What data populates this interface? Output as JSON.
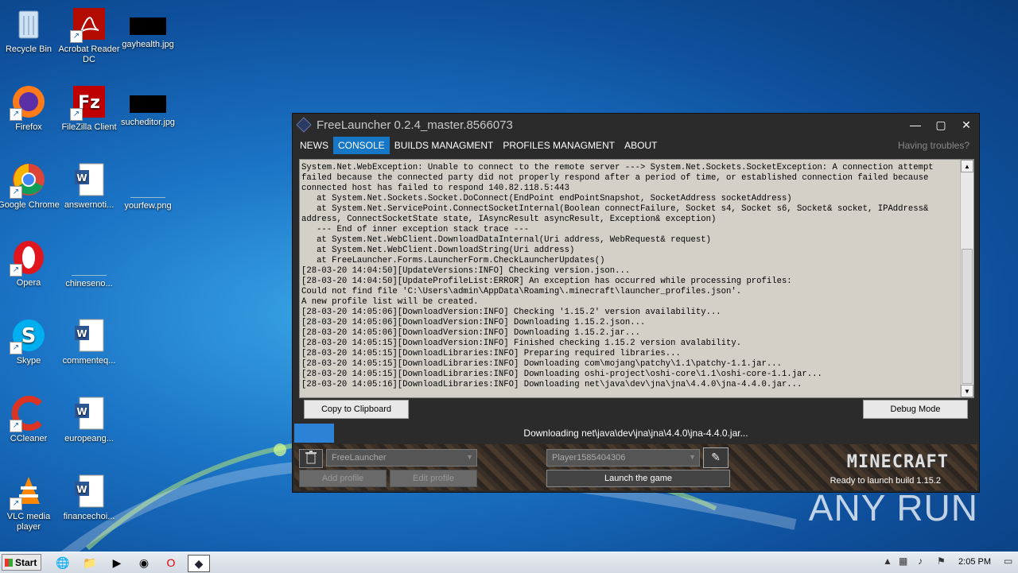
{
  "desktop": {
    "icons": [
      {
        "label": "Recycle Bin"
      },
      {
        "label": "Acrobat Reader DC"
      },
      {
        "label": "gayhealth.jpg"
      },
      {
        "label": "Firefox"
      },
      {
        "label": "FileZilla Client"
      },
      {
        "label": "sucheditor.jpg"
      },
      {
        "label": "Google Chrome"
      },
      {
        "label": "answernoti..."
      },
      {
        "label": "yourfew.png"
      },
      {
        "label": "Opera"
      },
      {
        "label": "chineseno..."
      },
      {
        "label": "Skype"
      },
      {
        "label": "commenteq..."
      },
      {
        "label": "CCleaner"
      },
      {
        "label": "europeang..."
      },
      {
        "label": "VLC media player"
      },
      {
        "label": "financechoi..."
      }
    ]
  },
  "window": {
    "title": "FreeLauncher 0.2.4_master.8566073",
    "controls": {
      "minimize": "—",
      "maximize": "▢",
      "close": "✕"
    },
    "tabs": [
      {
        "label": "NEWS"
      },
      {
        "label": "CONSOLE"
      },
      {
        "label": "BUILDS MANAGMENT"
      },
      {
        "label": "PROFILES MANAGMENT"
      },
      {
        "label": "ABOUT"
      }
    ],
    "help": "Having troubles?",
    "console_log": "System.Net.WebException: Unable to connect to the remote server ---> System.Net.Sockets.SocketException: A connection attempt failed because the connected party did not properly respond after a period of time, or established connection failed because connected host has failed to respond 140.82.118.5:443\n   at System.Net.Sockets.Socket.DoConnect(EndPoint endPointSnapshot, SocketAddress socketAddress)\n   at System.Net.ServicePoint.ConnectSocketInternal(Boolean connectFailure, Socket s4, Socket s6, Socket& socket, IPAddress& address, ConnectSocketState state, IAsyncResult asyncResult, Exception& exception)\n   --- End of inner exception stack trace ---\n   at System.Net.WebClient.DownloadDataInternal(Uri address, WebRequest& request)\n   at System.Net.WebClient.DownloadString(Uri address)\n   at FreeLauncher.Forms.LauncherForm.CheckLauncherUpdates()\n[28-03-20 14:04:50][UpdateVersions:INFO] Checking version.json...\n[28-03-20 14:04:50][UpdateProfileList:ERROR] An exception has occurred while processing profiles:\nCould not find file 'C:\\Users\\admin\\AppData\\Roaming\\.minecraft\\launcher_profiles.json'.\nA new profile list will be created.\n[28-03-20 14:05:06][DownloadVersion:INFO] Checking '1.15.2' version availability...\n[28-03-20 14:05:06][DownloadVersion:INFO] Downloading 1.15.2.json...\n[28-03-20 14:05:06][DownloadVersion:INFO] Downloading 1.15.2.jar...\n[28-03-20 14:05:15][DownloadVersion:INFO] Finished checking 1.15.2 version avalability.\n[28-03-20 14:05:15][DownloadLibraries:INFO] Preparing required libraries...\n[28-03-20 14:05:15][DownloadLibraries:INFO] Downloading com\\mojang\\patchy\\1.1\\patchy-1.1.jar...\n[28-03-20 14:05:15][DownloadLibraries:INFO] Downloading oshi-project\\oshi-core\\1.1\\oshi-core-1.1.jar...\n[28-03-20 14:05:16][DownloadLibraries:INFO] Downloading net\\java\\dev\\jna\\jna\\4.4.0\\jna-4.4.0.jar...",
    "copy_button": "Copy to Clipboard",
    "debug_button": "Debug Mode",
    "progress_text": "Downloading net\\java\\dev\\jna\\jna\\4.4.0\\jna-4.4.0.jar...",
    "profile_select": "FreeLauncher",
    "add_profile": "Add profile",
    "edit_profile": "Edit profile",
    "user_select": "Player1585404306",
    "launch": "Launch the game",
    "mc_logo": "MINECRAFT",
    "ready": "Ready to launch build 1.15.2"
  },
  "taskbar": {
    "start": "Start",
    "clock": "2:05 PM"
  },
  "watermark": "ANY RUN"
}
